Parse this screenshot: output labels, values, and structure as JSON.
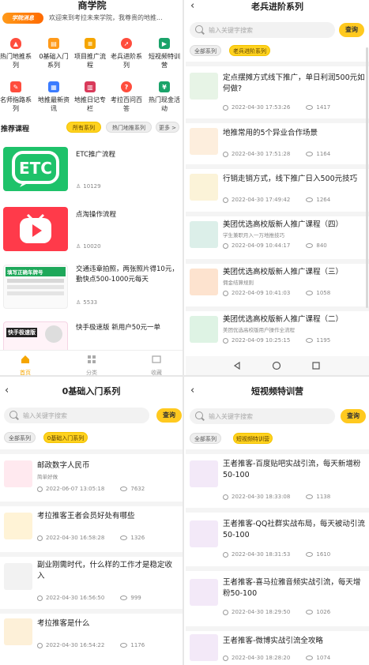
{
  "home": {
    "title": "商学院",
    "notice_logo": "学院消息",
    "notice_text": "欢迎来到考拉未来学院，我尊贵的地推...",
    "grid": [
      {
        "label": "热门地推系列",
        "icon": "fire-icon",
        "color": "#ff4d3d"
      },
      {
        "label": "0基础入门系列",
        "icon": "book-icon",
        "color": "#ff9a1a"
      },
      {
        "label": "项目推广流程",
        "icon": "clipboard-icon",
        "color": "#f5a500"
      },
      {
        "label": "老兵进阶系列",
        "icon": "rocket-icon",
        "color": "#ff4d3d"
      },
      {
        "label": "短视频特训营",
        "icon": "video-icon",
        "color": "#1aa36a"
      },
      {
        "label": "名师指路系列",
        "icon": "teacher-icon",
        "color": "#ff4d3d"
      },
      {
        "label": "地推最新资讯",
        "icon": "news-icon",
        "color": "#3b7cff"
      },
      {
        "label": "地推日记专栏",
        "icon": "diary-icon",
        "color": "#d93a5a"
      },
      {
        "label": "考拉百问百答",
        "icon": "qa-icon",
        "color": "#ff4d3d"
      },
      {
        "label": "热门现金活动",
        "icon": "cash-icon",
        "color": "#1aa36a"
      }
    ],
    "section_title": "推荐课程",
    "chips": [
      "所有系列",
      "热门地推系列",
      "更多 >"
    ],
    "courses": [
      {
        "title": "ETC推广流程",
        "count": "10129"
      },
      {
        "title": "点淘操作流程",
        "count": "10020"
      },
      {
        "title": "交通违章拍照，两张照片得10元，勤快点500-1000元每天",
        "count": "5533",
        "thumb_text": "填写正确车牌号"
      },
      {
        "title": "快手极速版 新用户50元一单",
        "count": "",
        "thumb_text": "快手极速版"
      }
    ],
    "tabs": [
      "首页",
      "分类",
      "收藏"
    ]
  },
  "veteran": {
    "title": "老兵进阶系列",
    "placeholder": "输入关键字搜索",
    "search_btn": "查询",
    "chips": [
      "全部系列",
      "老兵进阶系列"
    ],
    "items": [
      {
        "title": "定点摆摊方式线下推广，单日利润500元如何做?",
        "sub": "",
        "date": "2022-04-30 17:53:26",
        "views": "1417"
      },
      {
        "title": "地推常用的5个异业合作场景",
        "sub": "",
        "date": "2022-04-30 17:51:28",
        "views": "1164"
      },
      {
        "title": "行销走销方式，线下推广日入500元技巧",
        "sub": "",
        "date": "2022-04-30 17:49:42",
        "views": "1264"
      },
      {
        "title": "美团优选高校版新人推广课程（四）",
        "sub": "学生兼职月入一万地推技巧",
        "date": "2022-04-09 10:44:17",
        "views": "840"
      },
      {
        "title": "美团优选高校版新人推广课程（三）",
        "sub": "佣金结算规则",
        "date": "2022-04-09 10:41:03",
        "views": "1058"
      },
      {
        "title": "美团优选高校版新人推广课程（二）",
        "sub": "美团优选高校版用户操作全流程",
        "date": "2022-04-09 10:25:15",
        "views": "1195"
      }
    ]
  },
  "beginner": {
    "title": "0基础入门系列",
    "placeholder": "输入关键字搜索",
    "search_btn": "查询",
    "chips": [
      "全部系列",
      "0基础入门系列"
    ],
    "items": [
      {
        "title": "邮政数字人民币",
        "sub": "简单好做",
        "date": "2022-06-07 13:05:18",
        "views": "7632"
      },
      {
        "title": "考拉推客王者会员好处有哪些",
        "sub": "",
        "date": "2022-04-30 16:58:28",
        "views": "1326"
      },
      {
        "title": "副业刚需时代，什么样的工作才是稳定收入",
        "sub": "",
        "date": "2022-04-30 16:56:50",
        "views": "999"
      },
      {
        "title": "考拉推客是什么",
        "sub": "",
        "date": "2022-04-30 16:54:22",
        "views": "1176"
      }
    ]
  },
  "shortvideo": {
    "title": "短视频特训营",
    "placeholder": "输入关键字搜索",
    "search_btn": "查询",
    "chips": [
      "全部系列",
      "短视频特训营"
    ],
    "items": [
      {
        "title": "王者推客-百度贴吧实战引流，每天新增粉50-100",
        "date": "2022-04-30 18:33:08",
        "views": "1138"
      },
      {
        "title": "王者推客-QQ社群实战布局，每天被动引流50-100",
        "date": "2022-04-30 18:31:53",
        "views": "1610"
      },
      {
        "title": "王者推客-喜马拉雅音频实战引流，每天增粉50-100",
        "date": "2022-04-30 18:29:50",
        "views": "1026"
      },
      {
        "title": "王者推客-微博实战引流全攻略",
        "date": "2022-04-30 18:28:20",
        "views": "1074"
      }
    ]
  }
}
